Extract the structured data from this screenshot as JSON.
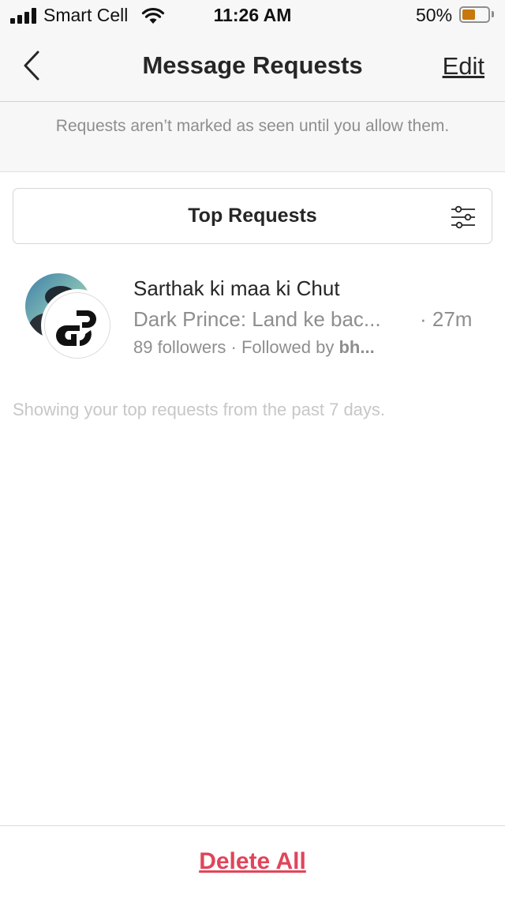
{
  "status_bar": {
    "carrier": "Smart Cell",
    "time": "11:26 AM",
    "battery_percent": "50%",
    "battery_level": 0.5,
    "battery_color": "#c7770e",
    "signal_bars": 3,
    "icons": [
      "signal-icon",
      "wifi-icon",
      "battery-icon"
    ]
  },
  "nav": {
    "back_icon": "chevron-left-icon",
    "title": "Message Requests",
    "edit_label": "Edit"
  },
  "notice": {
    "text": "Requests aren’t marked as seen until you allow them."
  },
  "top_requests": {
    "label": "Top Requests",
    "filter_icon": "sliders-icon"
  },
  "requests": [
    {
      "name": "Sarthak ki maa ki Chut",
      "preview": "Dark Prince: Land ke bac...",
      "time": "· 27m",
      "followers": "89 followers",
      "separator": "·",
      "followed_by_prefix": "Followed by",
      "followed_by_name": "bh..."
    }
  ],
  "footer_note": "Showing your top requests from the past 7 days.",
  "bottom": {
    "delete_all_label": "Delete All",
    "accent_color": "#e0455a"
  }
}
